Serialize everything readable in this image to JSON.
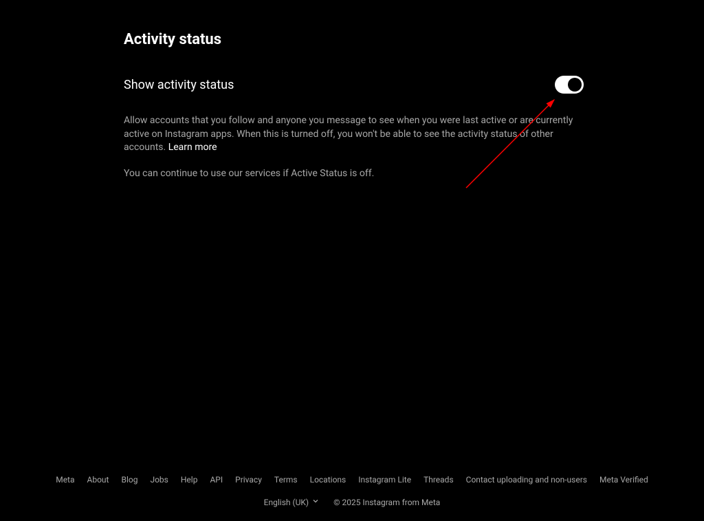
{
  "page": {
    "title": "Activity status"
  },
  "setting": {
    "label": "Show activity status",
    "toggle_on": true,
    "description_part1": "Allow accounts that you follow and anyone you message to see when you were last active or are currently active on Instagram apps. When this is turned off, you won't be able to see the activity status of other accounts. ",
    "learn_more": "Learn more",
    "secondary": "You can continue to use our services if Active Status is off."
  },
  "footer": {
    "links": [
      "Meta",
      "About",
      "Blog",
      "Jobs",
      "Help",
      "API",
      "Privacy",
      "Terms",
      "Locations",
      "Instagram Lite",
      "Threads",
      "Contact uploading and non-users",
      "Meta Verified"
    ],
    "language": "English (UK)",
    "copyright": "© 2025 Instagram from Meta"
  }
}
